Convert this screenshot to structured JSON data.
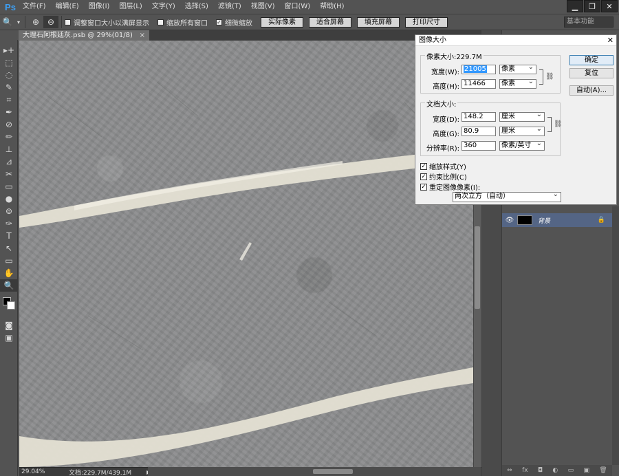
{
  "app": {
    "logo": "Ps"
  },
  "menubar": {
    "items": [
      "文件(F)",
      "编辑(E)",
      "图像(I)",
      "图层(L)",
      "文字(Y)",
      "选择(S)",
      "滤镜(T)",
      "视图(V)",
      "窗口(W)",
      "帮助(H)"
    ]
  },
  "window_controls": {
    "minimize": "▁",
    "restore": "❐",
    "close": "✕"
  },
  "options": {
    "zoom_in_icon": "⊕",
    "zoom_out_icon": "⊖",
    "resize_windows_label": "调整窗口大小以满屏显示",
    "zoom_all_label": "缩放所有窗口",
    "scrubby_zoom_label": "细微缩放",
    "actual_pixels_btn": "实际像素",
    "fit_screen_btn": "适合屏幕",
    "fill_screen_btn": "填充屏幕",
    "print_size_btn": "打印尺寸",
    "workspace": "基本功能"
  },
  "document": {
    "tab_title": "大理石阿根廷灰.psb @ 29%(01/8)",
    "tab_close": "×",
    "zoom_status": "29.04%",
    "doc_size_status": "文档:229.7M/439.1M",
    "status_arrow": "▶"
  },
  "layers": {
    "layer_name": "背景",
    "eye": "👁",
    "lock": "🔒",
    "footer_icons": [
      "⇔",
      "fx",
      "◘",
      "◐",
      "▭",
      "▣",
      "🗑"
    ]
  },
  "dialog": {
    "title": "图像大小",
    "close": "✕",
    "pixel_dimensions_label": "像素大小:229.7M",
    "width_label": "宽度(W):",
    "width_value": "21005",
    "width_unit": "像素",
    "height_label": "高度(H):",
    "height_value": "11466",
    "height_unit": "像素",
    "document_size_label": "文档大小:",
    "doc_width_label": "宽度(D):",
    "doc_width_value": "148.2",
    "doc_width_unit": "厘米",
    "doc_height_label": "高度(G):",
    "doc_height_value": "80.9",
    "doc_height_unit": "厘米",
    "resolution_label": "分辨率(R):",
    "resolution_value": "360",
    "resolution_unit": "像素/英寸",
    "scale_styles_label": "缩放样式(Y)",
    "constrain_label": "约束比例(C)",
    "resample_label": "重定图像像素(I):",
    "resample_method": "两次立方（自动）",
    "ok_btn": "确定",
    "reset_btn": "复位",
    "auto_btn": "自动(A)...",
    "link_icon": "⛓"
  },
  "tools": [
    "▸+",
    "⬚",
    "◌",
    "✎",
    "⌗",
    "✒",
    "⊘",
    "✏",
    "⊥",
    "⊿",
    "✂",
    "▭",
    "●",
    "⊚",
    "✑",
    "T",
    "↖",
    "▭",
    "✋",
    "🔍"
  ]
}
